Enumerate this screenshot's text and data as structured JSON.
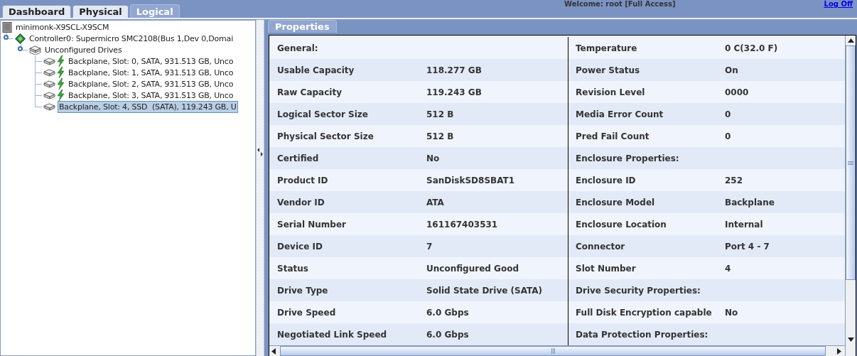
{
  "header": {
    "welcome": "Welcome: root [Full Access]",
    "logoff": "Log Off"
  },
  "tabs": [
    {
      "label": "Dashboard",
      "selected": false
    },
    {
      "label": "Physical",
      "selected": false
    },
    {
      "label": "Logical",
      "selected": true
    }
  ],
  "tree": {
    "label": "minimonk-X9SCL-X9SCM",
    "kind": "server",
    "selected": false,
    "children": [
      {
        "label": "Controller0: Supermicro SMC2108(Bus 1,Dev 0,Domai",
        "kind": "controller",
        "expanded": true,
        "selected": false,
        "children": [
          {
            "label": "Unconfigured Drives",
            "kind": "group",
            "expanded": true,
            "selected": false,
            "children": [
              {
                "label": "Backplane, Slot: 0, SATA, 931.513 GB, Unco",
                "kind": "hdd",
                "selected": false
              },
              {
                "label": "Backplane, Slot: 1, SATA, 931.513 GB, Unco",
                "kind": "hdd",
                "selected": false
              },
              {
                "label": "Backplane, Slot: 2, SATA, 931.513 GB, Unco",
                "kind": "hdd",
                "selected": false
              },
              {
                "label": "Backplane, Slot: 3, SATA, 931.513 GB, Unco",
                "kind": "hdd",
                "selected": false
              },
              {
                "label": "Backplane, Slot: 4, SSD  (SATA), 119.243 GB, U",
                "kind": "ssd",
                "selected": true
              }
            ]
          }
        ]
      }
    ]
  },
  "properties_tab": {
    "label": "Properties",
    "selected": true
  },
  "properties": {
    "left": [
      {
        "label": "General:"
      },
      {
        "label": "Usable Capacity",
        "value": "118.277 GB"
      },
      {
        "label": "Raw Capacity",
        "value": "119.243 GB"
      },
      {
        "label": "Logical Sector Size",
        "value": "512 B"
      },
      {
        "label": "Physical Sector Size",
        "value": "512 B"
      },
      {
        "label": "Certified",
        "value": "No"
      },
      {
        "label": "Product ID",
        "value": "SanDiskSD8SBAT1"
      },
      {
        "label": "Vendor ID",
        "value": "ATA"
      },
      {
        "label": "Serial Number",
        "value": "161167403531"
      },
      {
        "label": "Device ID",
        "value": "7"
      },
      {
        "label": "Status",
        "value": "Unconfigured Good"
      },
      {
        "label": "Drive Type",
        "value": "Solid State Drive (SATA)"
      },
      {
        "label": "Drive Speed",
        "value": "6.0 Gbps"
      },
      {
        "label": "Negotiated Link Speed",
        "value": "6.0 Gbps"
      }
    ],
    "right": [
      {
        "label": "Temperature",
        "value": "0 C(32.0 F)"
      },
      {
        "label": "Power Status",
        "value": "On"
      },
      {
        "label": "Revision Level",
        "value": "0000"
      },
      {
        "label": "Media Error Count",
        "value": "0"
      },
      {
        "label": "Pred Fail Count",
        "value": "0"
      },
      {
        "label": "Enclosure Properties:"
      },
      {
        "label": "Enclosure ID",
        "value": "252"
      },
      {
        "label": "Enclosure Model",
        "value": "Backplane"
      },
      {
        "label": "Enclosure Location",
        "value": "Internal"
      },
      {
        "label": "Connector",
        "value": "Port 4 - 7"
      },
      {
        "label": "Slot Number",
        "value": "4"
      },
      {
        "label": "Drive Security Properties:"
      },
      {
        "label": "Full Disk Encryption capable",
        "value": "No"
      },
      {
        "label": "Data Protection Properties:"
      }
    ]
  }
}
